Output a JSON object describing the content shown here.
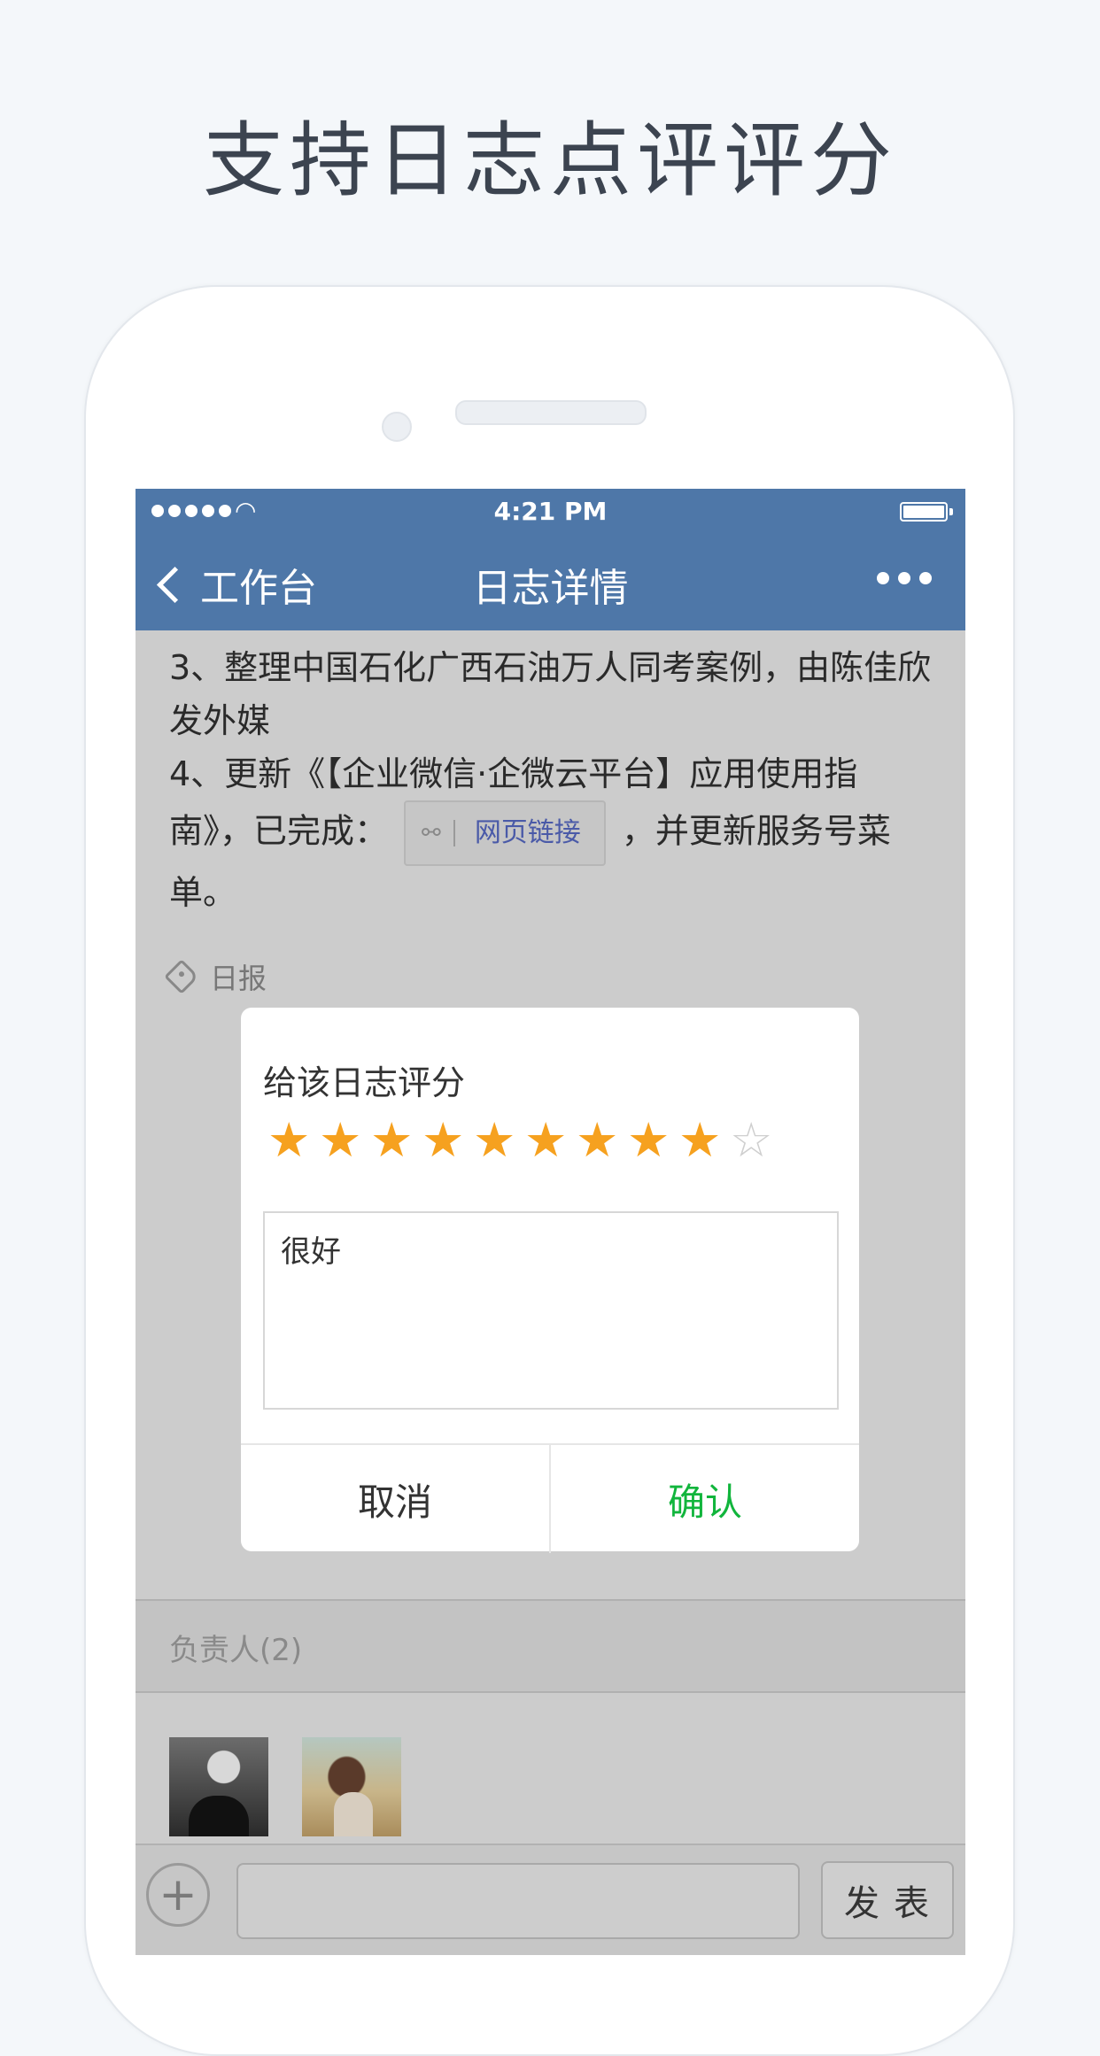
{
  "headline": "支持日志点评评分",
  "status_bar": {
    "time": "4:21 PM"
  },
  "nav": {
    "back_label": "工作台",
    "title": "日志详情"
  },
  "content": {
    "line_3": "3、整理中国石化广西石油万人同考案例，由陈佳欣发外媒",
    "line_4_before": "4、更新《【企业微信·企微云平台】应用使用指南》，已完成：",
    "link_label": "网页链接",
    "line_4_after": "，并更新服务号菜单。",
    "tag": "日报"
  },
  "rating_dialog": {
    "title": "给该日志评分",
    "rating": 9,
    "max_rating": 10,
    "comment": "很好",
    "cancel_label": "取消",
    "confirm_label": "确认",
    "accent_color": "#11b53c",
    "star_color": "#f6a11f"
  },
  "owners": {
    "label": "负责人(2)"
  },
  "bottom_bar": {
    "send_label": "发表"
  },
  "colors": {
    "nav_bg": "#4e77a8"
  }
}
